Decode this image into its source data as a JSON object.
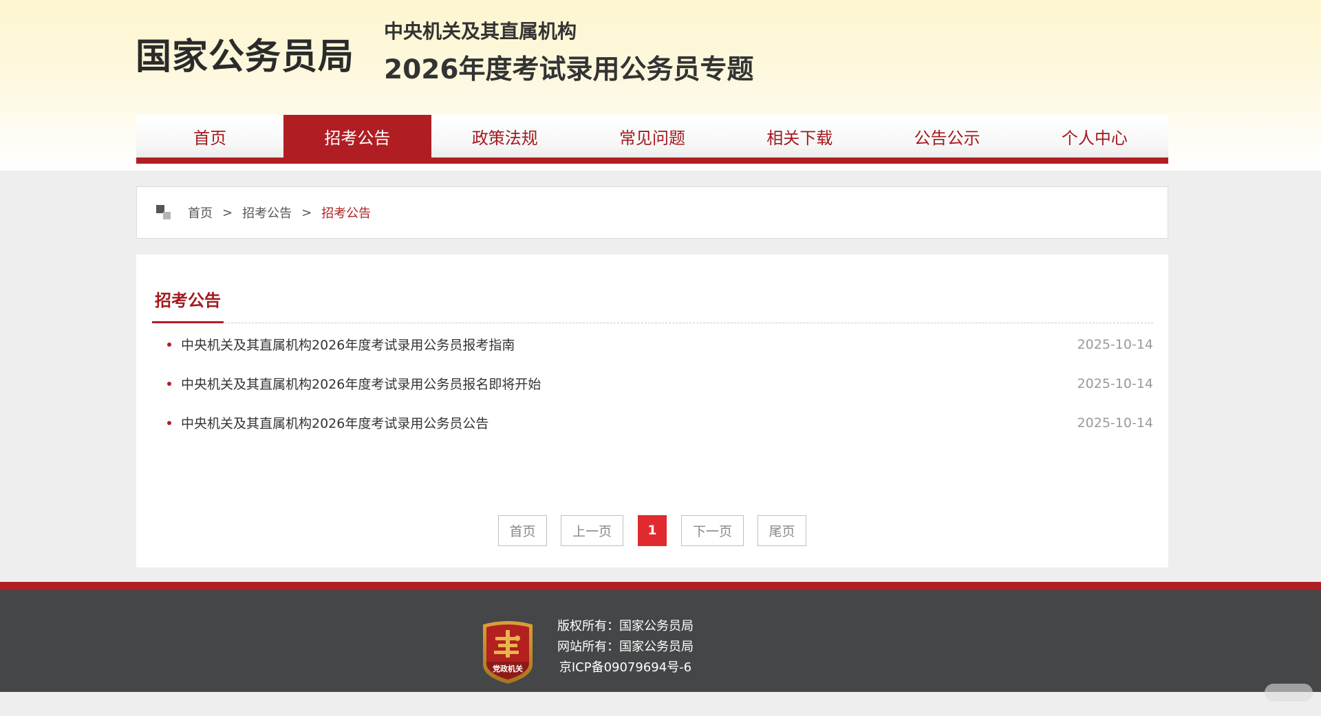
{
  "header": {
    "brand": "国家公务员局",
    "subtitle_line1": "中央机关及其直属机构",
    "subtitle_line2": "2026年度考试录用公务员专题"
  },
  "nav": {
    "items": [
      {
        "label": "首页",
        "active": false
      },
      {
        "label": "招考公告",
        "active": true
      },
      {
        "label": "政策法规",
        "active": false
      },
      {
        "label": "常见问题",
        "active": false
      },
      {
        "label": "相关下载",
        "active": false
      },
      {
        "label": "公告公示",
        "active": false
      },
      {
        "label": "个人中心",
        "active": false
      }
    ]
  },
  "breadcrumb": {
    "home": "首页",
    "separator": ">",
    "parent": "招考公告",
    "current": "招考公告"
  },
  "section": {
    "title": "招考公告",
    "items": [
      {
        "title": "中央机关及其直属机构2026年度考试录用公务员报考指南",
        "date": "2025-10-14"
      },
      {
        "title": "中央机关及其直属机构2026年度考试录用公务员报名即将开始",
        "date": "2025-10-14"
      },
      {
        "title": "中央机关及其直属机构2026年度考试录用公务员公告",
        "date": "2025-10-14"
      }
    ]
  },
  "pagination": {
    "first": "首页",
    "prev": "上一页",
    "current": "1",
    "next": "下一页",
    "last": "尾页"
  },
  "footer": {
    "copyright": "版权所有：国家公务员局",
    "owner": "网站所有：国家公务员局",
    "icp": "京ICP备09079694号-6",
    "logo_text": "党政机关"
  },
  "colors": {
    "accent_red": "#b01e23",
    "page_active_red": "#e02a2f",
    "footer_bg": "#454648"
  }
}
